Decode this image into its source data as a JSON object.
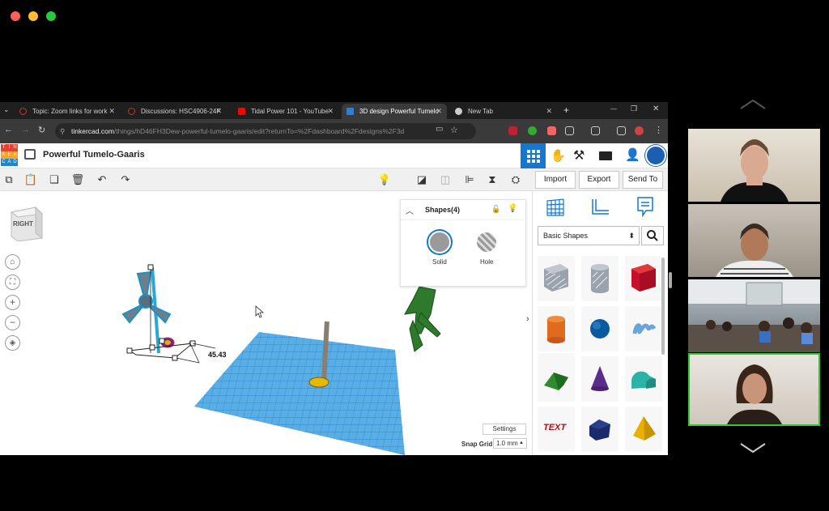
{
  "browser": {
    "tabs": [
      {
        "label": "Topic: Zoom links for work",
        "favicon_color": "#c0392b"
      },
      {
        "label": "Discussions: HSC4906-24F",
        "favicon_color": "#c0392b"
      },
      {
        "label": "Tidal Power 101 - YouTube",
        "favicon_color": "#ff0000"
      },
      {
        "label": "3D design Powerful Tumelo",
        "favicon_color": "#2e7dd7"
      },
      {
        "label": "New Tab",
        "favicon_color": "#aaaaaa"
      }
    ],
    "new_tab_symbol": "+",
    "url_domain": "tinkercad.com",
    "url_path": "/things/hD46FH3Dew-powerful-tumelo-gaaris/edit?returnTo=%2Fdashboard%2Fdesigns%2F3d"
  },
  "tinkercad": {
    "logo_letters": [
      "T",
      "I",
      "N",
      "K",
      "E",
      "R",
      "C",
      "A",
      "D"
    ],
    "design_title": "Powerful Tumelo-Gaaris",
    "view_cube_label": "RIGHT",
    "import_label": "Import",
    "export_label": "Export",
    "send_to_label": "Send To",
    "shapes_panel": {
      "title": "Shapes(4)",
      "solid_label": "Solid",
      "hole_label": "Hole"
    },
    "dimension_value": "45.43",
    "settings_label": "Settings",
    "snap_grid_label": "Snap Grid",
    "snap_grid_value": "1.0 mm",
    "library_category": "Basic Shapes",
    "text_shape_label": "TEXT"
  },
  "colors": {
    "tinkercad_blue": "#1477d2",
    "active_speaker": "#32c832"
  }
}
